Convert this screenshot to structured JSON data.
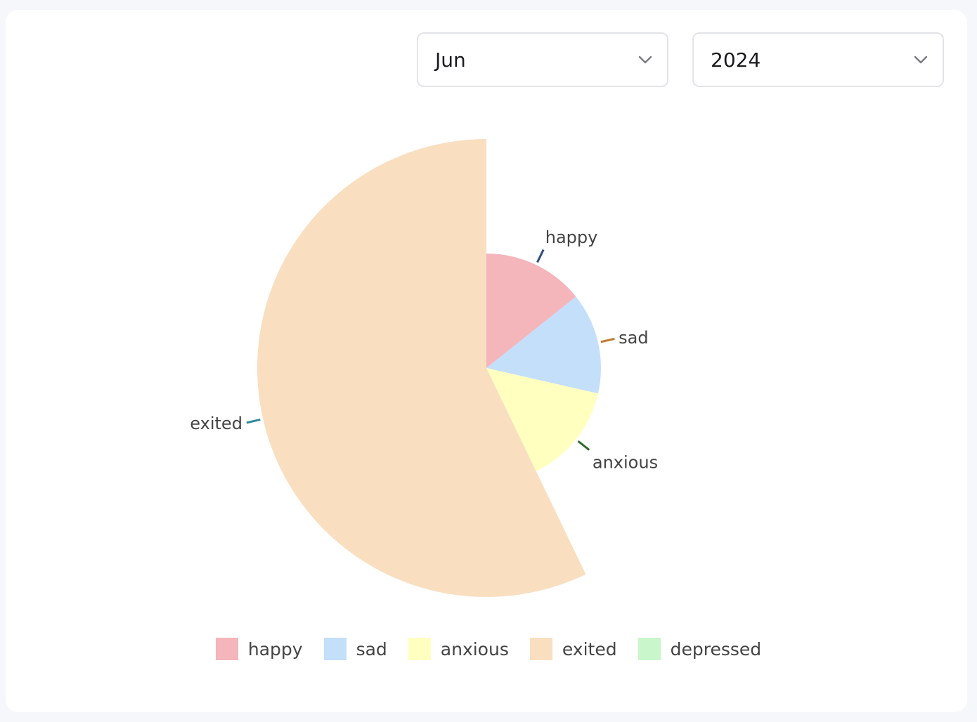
{
  "filters": {
    "month": {
      "value": "Jun",
      "icon": "chevron-down-icon"
    },
    "year": {
      "value": "2024",
      "icon": "chevron-down-icon"
    }
  },
  "chart_data": {
    "type": "pie",
    "variant": "rose",
    "title": "",
    "categories": [
      "happy",
      "sad",
      "anxious",
      "exited",
      "depressed"
    ],
    "values": [
      1,
      1,
      1,
      4,
      0
    ],
    "colors": [
      "#f4b5bb",
      "#c3dffa",
      "#ffffc0",
      "#f9dfc0",
      "#c9f7cb"
    ],
    "leader_colors": [
      "#2f4f7f",
      "#c07a30",
      "#2e6a2e",
      "#2f8a9a",
      "#3a9a3a"
    ],
    "legend_position": "bottom"
  }
}
